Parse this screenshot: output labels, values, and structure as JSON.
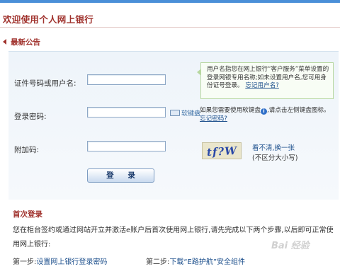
{
  "header": {
    "welcome": "欢迎使用个人网上银行"
  },
  "notice": {
    "title": "最新公告"
  },
  "form": {
    "id_label": "证件号码或用户名:",
    "password_label": "登录密码:",
    "captcha_label": "附加码:",
    "id_value": "",
    "password_value": "",
    "captcha_value": "",
    "soft_keyboard": "软键盘",
    "login_button": "登 录"
  },
  "tips": {
    "username_tip": "用户名指您在网上银行“客户服务”菜单设置的登录网银专用名称;如未设置用户名,您可用身份证号登录。",
    "forgot_username": "忘记用户名?",
    "keyboard_tip": "如果您需要使用软键盘",
    "keyboard_tip_tail": ",请点击左侧键盘图标。",
    "forgot_password": "忘记密码?"
  },
  "captcha": {
    "image_text": "tf?W",
    "refresh": "看不清,换一张",
    "case_note": "(不区分大小写)"
  },
  "first_login": {
    "title": "首次登录",
    "description": "您在柜台签约或通过网站开立并激活e账户后首次使用网上银行,请先完成以下两个步骤,以后即可正常使用网上银行:",
    "step1_prefix": "第一步:",
    "step1_link": "设置网上银行登录密码",
    "step2_prefix": "第二步:",
    "step2_link": "下载“E路护航”安全组件",
    "info_glyph": "i"
  },
  "watermark": {
    "text": "Bai 经验"
  },
  "colors": {
    "accent": "#a0322d",
    "link": "#1c4f8c",
    "panel": "#eef4fa",
    "top_bar": "#4a8fd8"
  }
}
